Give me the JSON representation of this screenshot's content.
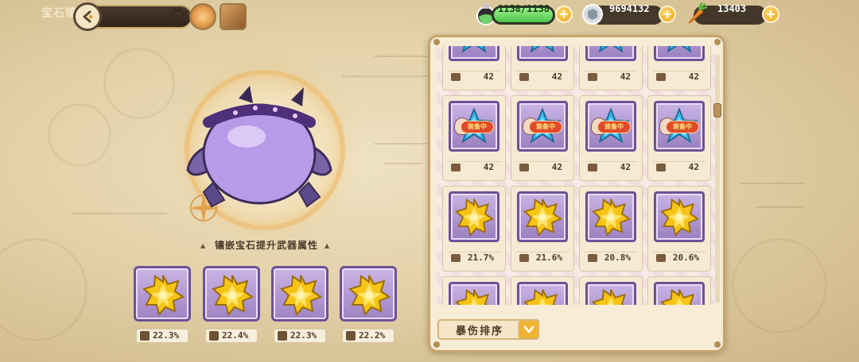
{
  "header": {
    "title": "宝石镶嵌",
    "back_icon": "back-arrow-icon"
  },
  "currencies": [
    {
      "name": "stamina",
      "value": "1138/1138",
      "icon": "potion-icon",
      "bar_fill": 1.0
    },
    {
      "name": "coins",
      "value": "9694132",
      "icon": "coin-icon"
    },
    {
      "name": "carrots",
      "value": "13403",
      "icon": "carrot-icon"
    }
  ],
  "inlay": {
    "section_label": "镶嵌宝石提升武器属性",
    "slots": [
      {
        "gem": "gold-star-gem",
        "value": "22.3%"
      },
      {
        "gem": "gold-star-gem",
        "value": "22.4%"
      },
      {
        "gem": "gold-star-gem",
        "value": "22.3%"
      },
      {
        "gem": "gold-star-gem",
        "value": "22.2%"
      }
    ]
  },
  "inventory": {
    "rows": [
      [
        {
          "gem": "blue-star-gem",
          "value": "42"
        },
        {
          "gem": "blue-star-gem",
          "value": "42"
        },
        {
          "gem": "blue-star-gem",
          "value": "42"
        },
        {
          "gem": "blue-star-gem",
          "value": "42"
        }
      ],
      [
        {
          "gem": "blue-star-gem",
          "value": "42",
          "badge": "装备中"
        },
        {
          "gem": "blue-star-gem",
          "value": "42",
          "badge": "装备中"
        },
        {
          "gem": "blue-star-gem",
          "value": "42",
          "badge": "装备中"
        },
        {
          "gem": "blue-star-gem",
          "value": "42",
          "badge": "装备中"
        }
      ],
      [
        {
          "gem": "gold-star-gem",
          "value": "21.7%"
        },
        {
          "gem": "gold-star-gem",
          "value": "21.6%"
        },
        {
          "gem": "gold-star-gem",
          "value": "20.8%"
        },
        {
          "gem": "gold-star-gem",
          "value": "20.6%"
        }
      ],
      [
        {
          "gem": "gold-star-gem"
        },
        {
          "gem": "gold-star-gem"
        },
        {
          "gem": "gold-star-gem"
        },
        {
          "gem": "gold-star-gem"
        }
      ]
    ],
    "sort_label": "暴伤排序"
  },
  "colors": {
    "slot_purple": "#9f82c4",
    "panel_cream": "#f7ecd6",
    "accent_gold": "#f0a51f",
    "equip_red": "#e04a2a"
  }
}
